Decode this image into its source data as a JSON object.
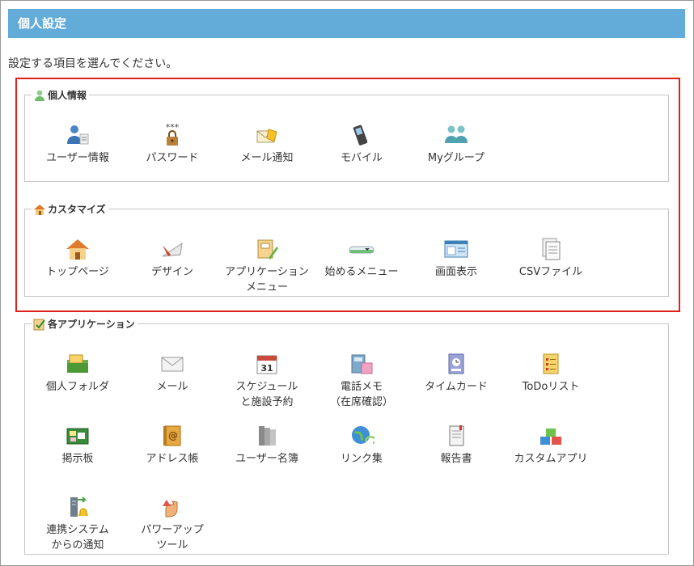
{
  "header": {
    "title": "個人設定"
  },
  "instruction": "設定する項目を選んでください。",
  "sections": {
    "personal": {
      "legend": "個人情報",
      "items": [
        {
          "label": "ユーザー情報"
        },
        {
          "label": "パスワード",
          "icon_text": "***"
        },
        {
          "label": "メール通知"
        },
        {
          "label": "モバイル"
        },
        {
          "label": "Myグループ"
        }
      ]
    },
    "customize": {
      "legend": "カスタマイズ",
      "items": [
        {
          "label": "トップページ"
        },
        {
          "label": "デザイン"
        },
        {
          "label": "アプリケーション",
          "label2": "メニュー"
        },
        {
          "label": "始めるメニュー"
        },
        {
          "label": "画面表示"
        },
        {
          "label": "CSVファイル"
        }
      ]
    },
    "applications": {
      "legend": "各アプリケーション",
      "items": [
        {
          "label": "個人フォルダ"
        },
        {
          "label": "メール"
        },
        {
          "label": "スケジュール",
          "label2": "と施設予約",
          "icon_text": "31"
        },
        {
          "label": "電話メモ",
          "label2": "（在席確認）"
        },
        {
          "label": "タイムカード"
        },
        {
          "label": "ToDoリスト"
        },
        {
          "label": "掲示板"
        },
        {
          "label": "アドレス帳",
          "icon_text": "@"
        },
        {
          "label": "ユーザー名簿"
        },
        {
          "label": "リンク集"
        },
        {
          "label": "報告書"
        },
        {
          "label": "カスタムアプリ"
        },
        {
          "label": "連携システム",
          "label2": "からの通知"
        },
        {
          "label": "パワーアップ",
          "label2": "ツール"
        }
      ]
    }
  },
  "colors": {
    "header_bg": "#63acd9",
    "highlight_border": "#e0201b",
    "fieldset_border": "#c6c6c6"
  }
}
